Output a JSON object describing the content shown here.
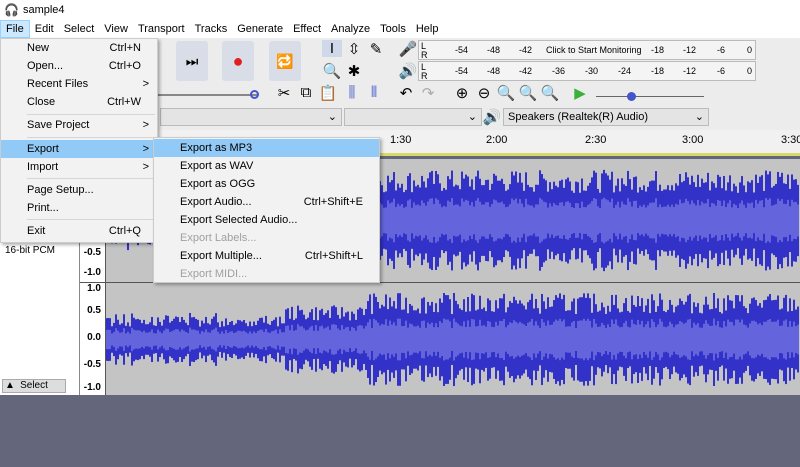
{
  "window": {
    "title": "sample4"
  },
  "menubar": [
    "File",
    "Edit",
    "Select",
    "View",
    "Transport",
    "Tracks",
    "Generate",
    "Effect",
    "Analyze",
    "Tools",
    "Help"
  ],
  "file_menu": [
    {
      "label": "New",
      "shortcut": "Ctrl+N"
    },
    {
      "label": "Open...",
      "shortcut": "Ctrl+O"
    },
    {
      "label": "Recent Files",
      "submenu": ">"
    },
    {
      "label": "Close",
      "shortcut": "Ctrl+W"
    },
    {
      "label": "Save Project",
      "submenu": ">"
    },
    {
      "label": "Export",
      "submenu": ">"
    },
    {
      "label": "Import",
      "submenu": ">"
    },
    {
      "label": "Page Setup..."
    },
    {
      "label": "Print..."
    },
    {
      "label": "Exit",
      "shortcut": "Ctrl+Q"
    }
  ],
  "export_menu": [
    {
      "label": "Export as MP3",
      "shortcut": ""
    },
    {
      "label": "Export as WAV",
      "shortcut": ""
    },
    {
      "label": "Export as OGG",
      "shortcut": ""
    },
    {
      "label": "Export Audio...",
      "shortcut": "Ctrl+Shift+E"
    },
    {
      "label": "Export Selected Audio...",
      "shortcut": ""
    },
    {
      "label": "Export Labels...",
      "shortcut": "",
      "disabled": true
    },
    {
      "label": "Export Multiple...",
      "shortcut": "Ctrl+Shift+L"
    },
    {
      "label": "Export MIDI...",
      "shortcut": "",
      "disabled": true
    }
  ],
  "meters": {
    "record_ticks": [
      "-54",
      "-48",
      "-42",
      "-18",
      "-12",
      "-6",
      "0"
    ],
    "record_prompt": "Click to Start Monitoring",
    "play_ticks": [
      "-54",
      "-48",
      "-42",
      "-36",
      "-30",
      "-24",
      "-18",
      "-12",
      "-6",
      "0"
    ],
    "channels": [
      "L",
      "R"
    ]
  },
  "devices": {
    "output": "Speakers (Realtek(R) Audio)"
  },
  "timeline": {
    "labels": [
      "1:30",
      "2:00",
      "2:30",
      "3:00",
      "3:30"
    ]
  },
  "track": {
    "format": "16-bit PCM",
    "select_label": "Select",
    "scale_top": [
      "-0.5",
      "-1.0"
    ],
    "scale_bottom": [
      "1.0",
      "0.5",
      "0.0",
      "-0.5",
      "-1.0"
    ]
  },
  "colors": {
    "waveform": "#3232c8",
    "waveform_rms": "#6464dc",
    "menu_highlight": "#91c9f7",
    "background": "#64667b"
  }
}
